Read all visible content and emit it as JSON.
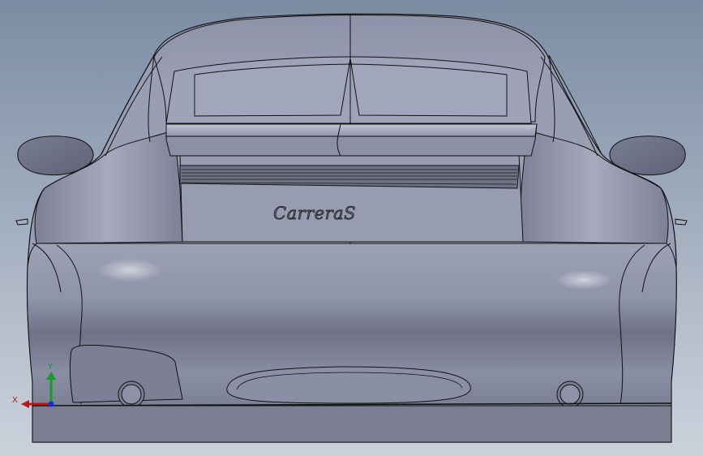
{
  "badge": {
    "text": "CarreraS"
  },
  "triad": {
    "x_label": "X",
    "y_label": "Y",
    "x_color": "#c0141a",
    "y_color": "#1b9a2a",
    "z_color": "#1a2bd0"
  },
  "colors": {
    "background_top": "#7e8fa6",
    "background_bottom": "#c9cfd9",
    "body": "#9a9eb3",
    "body_shadow": "#6b6e80",
    "edge": "#111111"
  }
}
